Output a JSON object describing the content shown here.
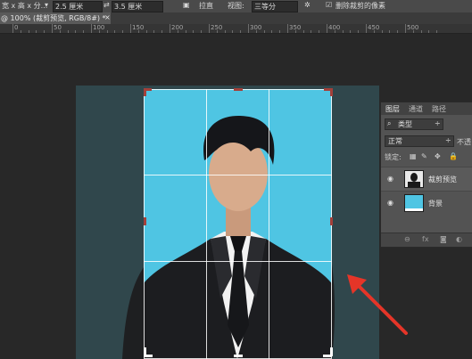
{
  "options_bar": {
    "ratio_label": "宽 x 高 x 分...",
    "width_value": "2.5 厘米",
    "height_value": "3.5 厘米",
    "straighten_label": "拉直",
    "view_label": "视图:",
    "view_value": "三等分",
    "delete_cropped_label": "删除裁剪的像素"
  },
  "document": {
    "tab_title": "@ 100% (裁剪预览, RGB/8#) *",
    "close_glyph": "×"
  },
  "ruler": {
    "labels": [
      "0",
      "50",
      "100",
      "150",
      "200",
      "250",
      "300",
      "350",
      "400",
      "450",
      "500"
    ]
  },
  "layers_panel": {
    "tabs": [
      "图层",
      "通道",
      "路径"
    ],
    "filter_label": "类型",
    "blend_mode": "正常",
    "opacity_label": "不透",
    "lock_label": "锁定:",
    "layers": [
      {
        "name": "裁剪预览",
        "visible": true,
        "thumb": "portrait"
      },
      {
        "name": "背景",
        "visible": true,
        "thumb": "blue"
      }
    ],
    "footer_icons": [
      "link-icon",
      "fx-icon",
      "mask-icon",
      "adjustment-icon"
    ],
    "footer_labels": [
      "⊖",
      "fx",
      "◙",
      "◐"
    ]
  },
  "colors": {
    "photo_bg": "#4fc5e3",
    "canvas_bg": "#30474c",
    "arrow": "#e53528",
    "handle": "#a3403a"
  }
}
